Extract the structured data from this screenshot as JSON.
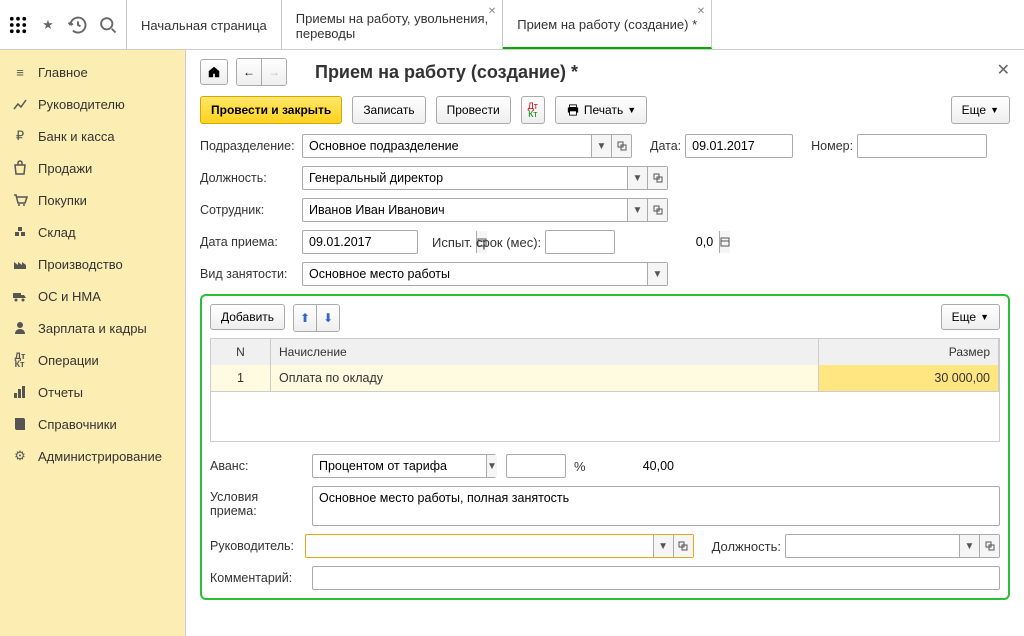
{
  "tabs": {
    "start": "Начальная страница",
    "t1a": "Приемы на работу, увольнения,",
    "t1b": "переводы",
    "t2": "Прием на работу (создание) *"
  },
  "sidebar": {
    "items": [
      {
        "label": "Главное"
      },
      {
        "label": "Руководителю"
      },
      {
        "label": "Банк и касса"
      },
      {
        "label": "Продажи"
      },
      {
        "label": "Покупки"
      },
      {
        "label": "Склад"
      },
      {
        "label": "Производство"
      },
      {
        "label": "ОС и НМА"
      },
      {
        "label": "Зарплата и кадры"
      },
      {
        "label": "Операции"
      },
      {
        "label": "Отчеты"
      },
      {
        "label": "Справочники"
      },
      {
        "label": "Администрирование"
      }
    ]
  },
  "page": {
    "title": "Прием на работу (создание) *",
    "buttons": {
      "post_close": "Провести и закрыть",
      "save": "Записать",
      "post": "Провести",
      "print": "Печать",
      "more": "Еще",
      "add": "Добавить"
    },
    "labels": {
      "division": "Подразделение:",
      "date": "Дата:",
      "number": "Номер:",
      "position": "Должность:",
      "employee": "Сотрудник:",
      "hire_date": "Дата приема:",
      "probation": "Испыт. срок (мес):",
      "employment": "Вид занятости:",
      "advance": "Аванс:",
      "pct": "%",
      "conditions": "Условия приема:",
      "manager": "Руководитель:",
      "mgr_position": "Должность:",
      "comment": "Комментарий:"
    },
    "values": {
      "division": "Основное подразделение",
      "date": "09.01.2017",
      "number": "",
      "position": "Генеральный директор",
      "employee": "Иванов Иван Иванович",
      "hire_date": "09.01.2017",
      "probation": "0,0",
      "employment": "Основное место работы",
      "advance_type": "Процентом от тарифа",
      "advance_val": "40,00",
      "conditions": "Основное место работы, полная занятость",
      "manager": "",
      "mgr_position": "",
      "comment": ""
    },
    "table": {
      "cols": {
        "n": "N",
        "name": "Начисление",
        "size": "Размер"
      },
      "rows": [
        {
          "n": "1",
          "name": "Оплата по окладу",
          "size": "30 000,00"
        }
      ]
    }
  }
}
